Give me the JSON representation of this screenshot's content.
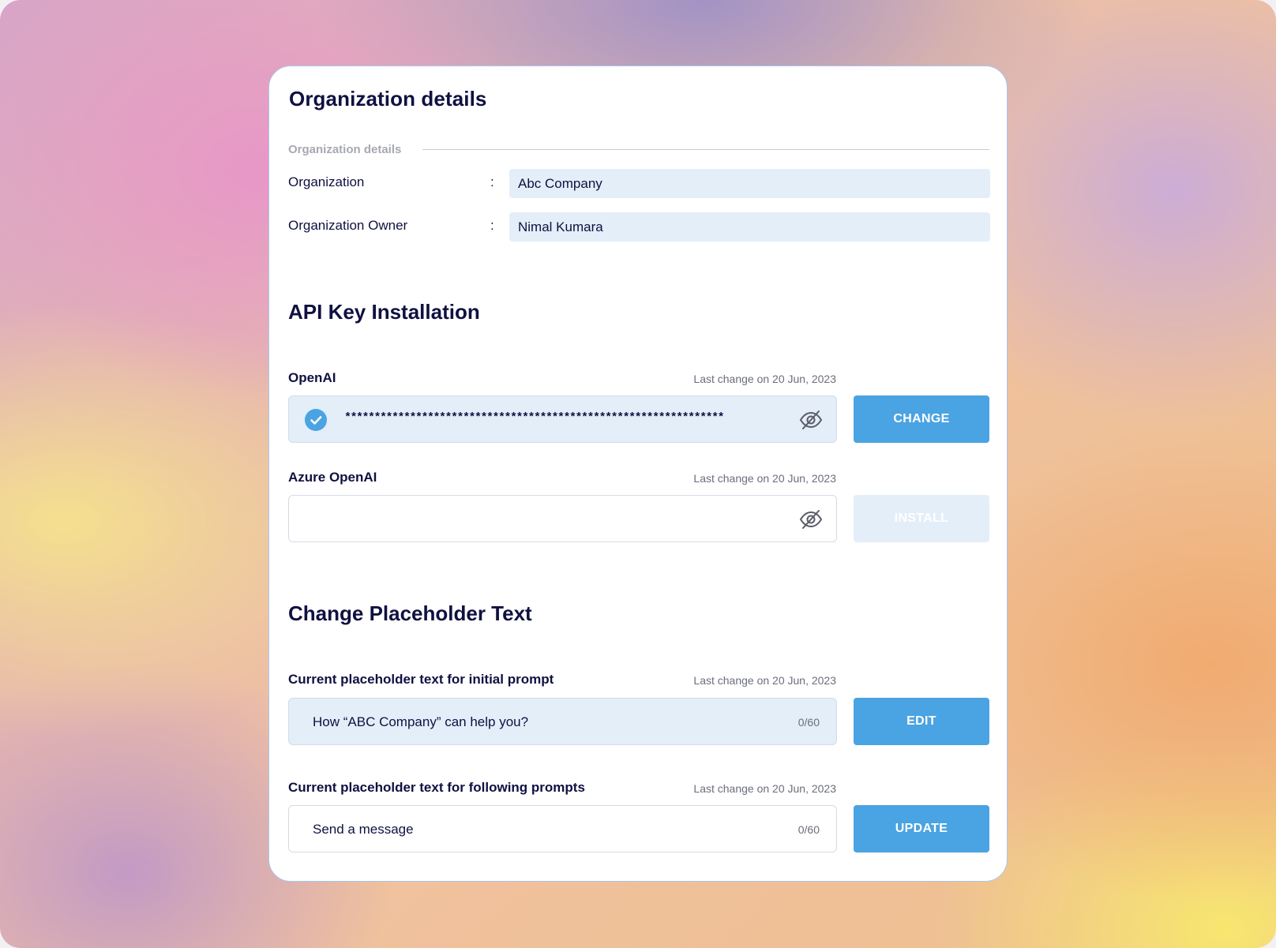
{
  "org_section": {
    "title": "Organization details",
    "divider_label": "Organization details",
    "rows": [
      {
        "label": "Organization",
        "colon": ":",
        "value": "Abc Company"
      },
      {
        "label": "Organization Owner",
        "colon": ":",
        "value": "Nimal Kumara"
      }
    ]
  },
  "api_section": {
    "title": "API Key Installation",
    "openai": {
      "label": "OpenAI",
      "last_change": "Last change on 20 Jun, 2023",
      "masked_value": "****************************************************************",
      "status_icon": "check-circle-icon",
      "toggle_icon": "eye-off-icon",
      "button": "CHANGE"
    },
    "azure": {
      "label": "Azure OpenAI",
      "last_change": "Last change on 20 Jun, 2023",
      "value": "",
      "toggle_icon": "eye-off-icon",
      "button": "INSTALL"
    }
  },
  "placeholder_section": {
    "title": "Change Placeholder Text",
    "initial": {
      "label": "Current placeholder text for initial prompt",
      "last_change": "Last change on 20 Jun, 2023",
      "value": "How “ABC Company” can help you?",
      "counter": "0/60",
      "button": "EDIT"
    },
    "following": {
      "label": "Current placeholder text for following prompts",
      "last_change": "Last change on 20 Jun, 2023",
      "value": "Send a message",
      "counter": "0/60",
      "button": "UPDATE"
    }
  },
  "colors": {
    "accent": "#4AA3E2",
    "field_fill": "#E3EEF9",
    "heading": "#0F1140",
    "muted": "#6B6E7C"
  }
}
